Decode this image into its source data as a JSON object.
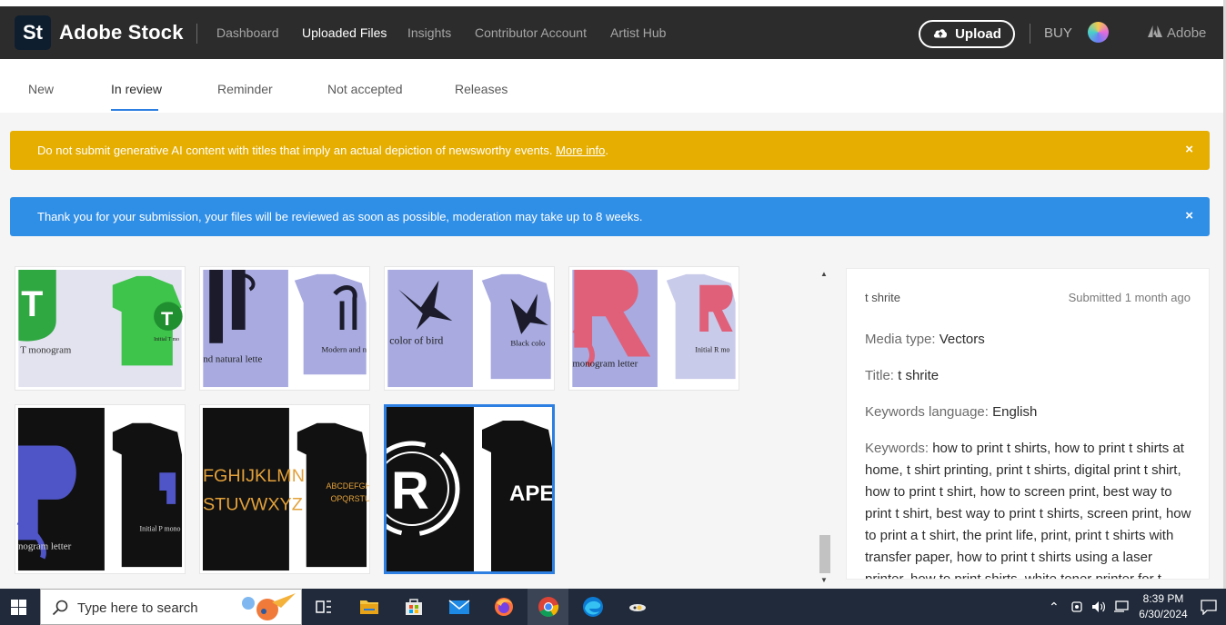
{
  "header": {
    "logo": "St",
    "brand": "Adobe Stock",
    "nav": [
      {
        "label": "Dashboard",
        "active": false
      },
      {
        "label": "Uploaded Files",
        "active": true
      },
      {
        "label": "Insights",
        "active": false
      },
      {
        "label": "Contributor Account",
        "active": false
      },
      {
        "label": "Artist Hub",
        "active": false
      }
    ],
    "upload_label": "Upload",
    "buy_label": "BUY",
    "adobe_label": "Adobe"
  },
  "tabs": [
    {
      "label": "New",
      "active": false
    },
    {
      "label": "In review",
      "active": true
    },
    {
      "label": "Reminder",
      "active": false
    },
    {
      "label": "Not accepted",
      "active": false
    },
    {
      "label": "Releases",
      "active": false
    }
  ],
  "banners": {
    "warning_text": "Do not submit generative AI content with titles that imply an actual depiction of newsworthy events.",
    "warning_link": "More info",
    "warning_tail": ".",
    "info_text": "Thank you for your submission, your files will be reviewed as soon as possible, moderation may take up to 8 weeks.",
    "close_glyph": "×"
  },
  "thumbnails": [
    {
      "caption_left": "T monogram",
      "caption_right": "Initial T mo",
      "selected": false
    },
    {
      "caption_left": "nd natural lette",
      "caption_right": "Modern and n",
      "selected": false
    },
    {
      "caption_left": "color of bird",
      "caption_right": "Black colo",
      "selected": false
    },
    {
      "caption_left": "monogram letter",
      "caption_right": "Initial R mo",
      "selected": false
    },
    {
      "caption_left": "nogram letter",
      "caption_right": "Initial P mono",
      "selected": false
    },
    {
      "caption_left": "FGHIJKLMN",
      "caption_left2": "STUVWXYZ",
      "caption_right": "ABCDEFGH",
      "caption_right2": "OPQRSTU",
      "selected": false
    },
    {
      "caption_left": "R",
      "caption_right": "APE",
      "selected": true
    }
  ],
  "detail": {
    "name": "t shrite",
    "submitted": "Submitted 1 month ago",
    "media_type_label": "Media type:",
    "media_type_value": "Vectors",
    "title_label": "Title:",
    "title_value": "t shrite",
    "keywords_language_label": "Keywords language:",
    "keywords_language_value": "English",
    "keywords_label": "Keywords:",
    "keywords_value": "how to print t shirts, how to print t shirts at home, t shirt printing, print t shirts, digital print t shirt, how to print t shirt, how to screen print, best way to print t shirt, best way to print t shirts, screen print, how to print a t shirt, the print life, print, print t shirts with transfer paper, how to print t shirts using a laser printer, how to print shirts, white toner printer for t shirts, t shirt"
  },
  "taskbar": {
    "search_placeholder": "Type here to search",
    "time": "8:39 PM",
    "date": "6/30/2024"
  },
  "colors": {
    "header_bg": "#2c2c2c",
    "accent_blue": "#2d7fe1",
    "warning_yellow": "#e6ae00",
    "info_blue": "#2f8ee6",
    "taskbar_bg": "#202a3a"
  }
}
